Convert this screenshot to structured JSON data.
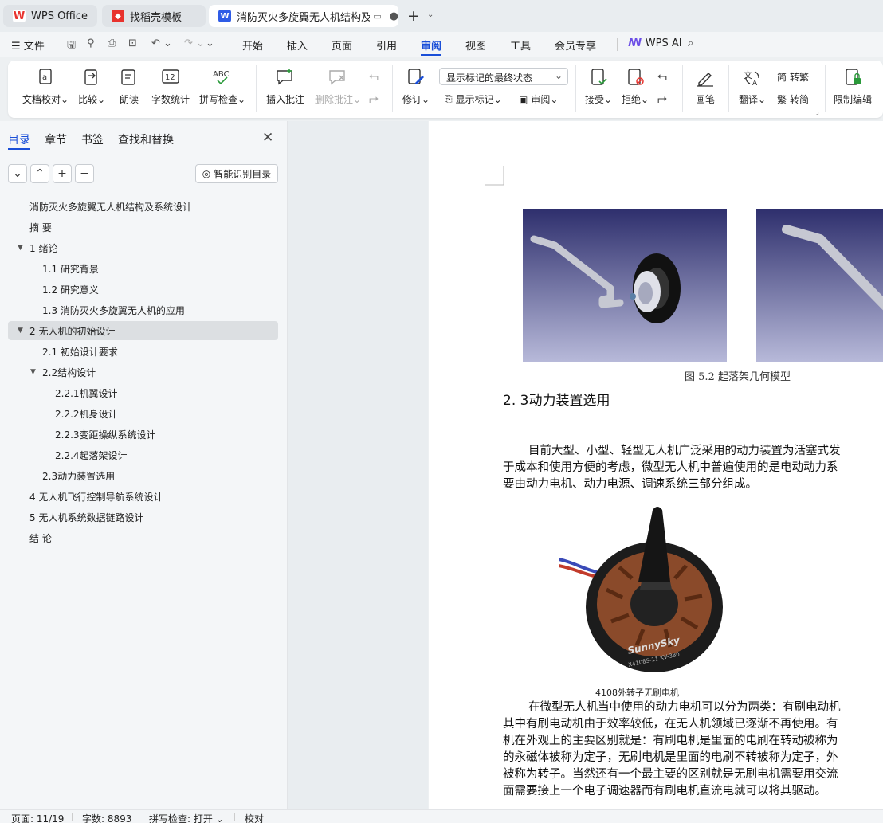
{
  "tabs": [
    {
      "label": "WPS Office",
      "icon": "wps-logo-icon"
    },
    {
      "label": "找稻壳模板",
      "icon": "docer-icon"
    },
    {
      "label": "消防灭火多旋翼无人机结构及系",
      "icon": "writer-doc-icon"
    }
  ],
  "menu": {
    "file": "文件",
    "items": [
      "开始",
      "插入",
      "页面",
      "引用",
      "审阅",
      "视图",
      "工具",
      "会员专享"
    ],
    "active": "审阅",
    "wps_ai": "WPS AI"
  },
  "ribbon": {
    "doc_check": "文档校对",
    "compare": "比较",
    "read_aloud": "朗读",
    "word_count": "字数统计",
    "spell_check": "拼写检查",
    "insert_comment": "插入批注",
    "delete_comment": "删除批注",
    "revise": "修订",
    "markup_mode": "显示标记的最终状态",
    "show_markup": "显示标记",
    "review": "审阅",
    "accept": "接受",
    "reject": "拒绝",
    "pen": "画笔",
    "translate": "翻译",
    "to_traditional": "转繁",
    "to_simplified": "转简",
    "restrict_edit": "限制编辑"
  },
  "panel": {
    "tabs": [
      "目录",
      "章节",
      "书签",
      "查找和替换"
    ],
    "smart_toc": "智能识别目录",
    "toc": [
      {
        "label": "消防灭火多旋翼无人机结构及系统设计",
        "level": 0
      },
      {
        "label": "摘  要",
        "level": 0
      },
      {
        "label": "1 绪论",
        "level": 0,
        "expanded": true
      },
      {
        "label": "1.1 研究背景",
        "level": 1
      },
      {
        "label": "1.2 研究意义",
        "level": 1
      },
      {
        "label": "1.3 消防灭火多旋翼无人机的应用",
        "level": 1
      },
      {
        "label": "2 无人机的初始设计",
        "level": 0,
        "expanded": true,
        "selected": true
      },
      {
        "label": "2.1 初始设计要求",
        "level": 1
      },
      {
        "label": "2.2结构设计",
        "level": 1,
        "expanded": true
      },
      {
        "label": "2.2.1机翼设计",
        "level": 2
      },
      {
        "label": "2.2.2机身设计",
        "level": 2
      },
      {
        "label": "2.2.3变距操纵系统设计",
        "level": 2
      },
      {
        "label": "2.2.4起落架设计",
        "level": 2
      },
      {
        "label": "2.3动力装置选用",
        "level": 1
      },
      {
        "label": "4 无人机飞行控制导航系统设计",
        "level": 0
      },
      {
        "label": "5 无人机系统数据链路设计",
        "level": 0
      },
      {
        "label": "结  论",
        "level": 0
      }
    ]
  },
  "document": {
    "figure_caption": "图 5.2  起落架几何模型",
    "heading": "2. 3动力装置选用",
    "para1": [
      "目前大型、小型、轻型无人机广泛采用的动力装置为活塞式发",
      "于成本和使用方便的考虑，微型无人机中普遍使用的是电动动力系",
      "要由动力电机、动力电源、调速系统三部分组成。"
    ],
    "motor_brand": "SunnySky",
    "motor_model": "X4108S-11 KV-380",
    "motor_caption": "4108外转子无刷电机",
    "para2": [
      "在微型无人机当中使用的动力电机可以分为两类：有刷电动机",
      "其中有刷电动机由于效率较低，在无人机领域已逐渐不再使用。有",
      "机在外观上的主要区别就是：有刷电机是里面的电刷在转动被称为",
      "的永磁体被称为定子，无刷电机是里面的电刷不转被称为定子，外",
      "被称为转子。当然还有一个最主要的区别就是无刷电机需要用交流",
      "面需要接上一个电子调速器而有刷电机直流电就可以将其驱动。"
    ]
  },
  "status": {
    "page": "页面: 11/19",
    "words": "字数: 8893",
    "spell": "拼写检查: 打开",
    "proof": "校对"
  },
  "colors": {
    "accent": "#1a4fd8",
    "wps_red": "#e8322d",
    "selected_row": "#dcdfe2"
  }
}
